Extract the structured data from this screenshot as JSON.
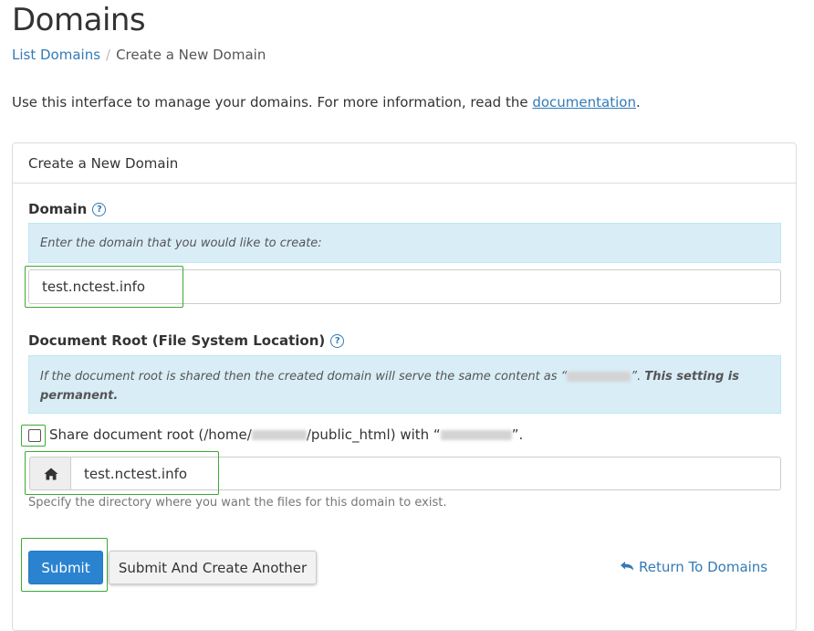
{
  "header": {
    "title": "Domains",
    "breadcrumb": {
      "link": "List Domains",
      "separator": "/",
      "current": "Create a New Domain"
    },
    "intro_text": "Use this interface to manage your domains. For more information, read the ",
    "intro_link": "documentation",
    "intro_end": "."
  },
  "panel": {
    "title": "Create a New Domain",
    "domain": {
      "label": "Domain",
      "info": "Enter the domain that you would like to create:",
      "value": "test.nctest.info"
    },
    "docroot": {
      "label": "Document Root (File System Location)",
      "info_prefix": "If the document root is shared then the created domain will serve the same content as “",
      "info_mid": "”. ",
      "info_bold": "This setting is permanent.",
      "share_prefix": "Share document root (/home/",
      "share_mid": "/public_html) with “",
      "share_end": "”.",
      "share_checked": false,
      "value": "test.nctest.info",
      "help_text": "Specify the directory where you want the files for this domain to exist."
    },
    "buttons": {
      "submit": "Submit",
      "submit_another": "Submit And Create Another",
      "return": "Return To Domains"
    }
  },
  "colors": {
    "accent": "#337ab7",
    "primary_button": "#2b83d0",
    "info_background": "#d9edf7",
    "highlight_border": "#3aaa35"
  },
  "icons": [
    "help-circle-icon",
    "home-icon",
    "undo-arrow-icon"
  ]
}
